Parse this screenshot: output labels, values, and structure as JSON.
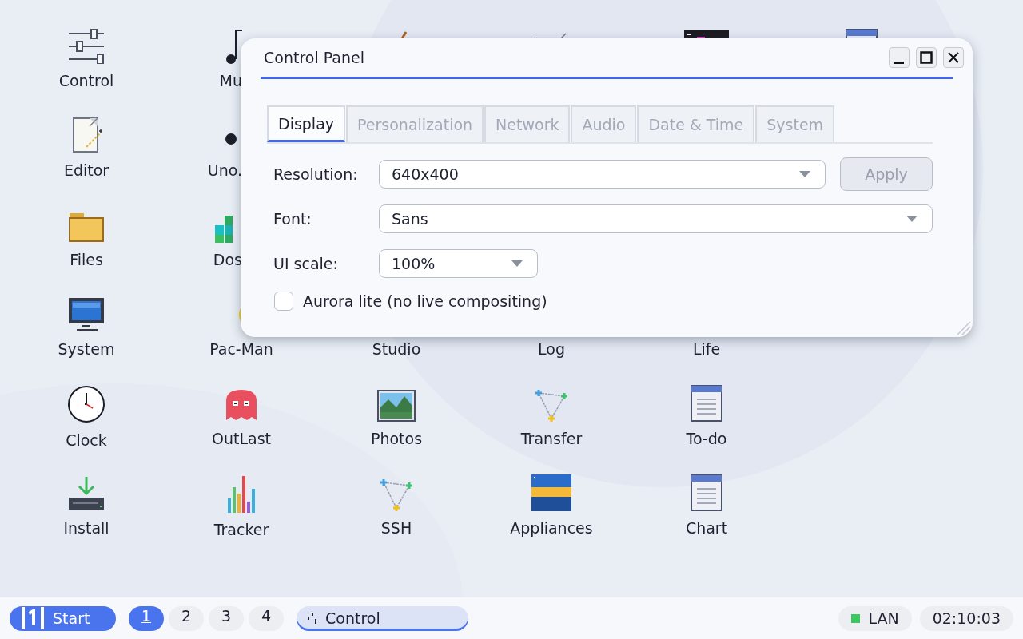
{
  "desktop": {
    "columns": [
      [
        {
          "kind": "app",
          "label": "Control"
        },
        {
          "kind": "app",
          "label": "Editor"
        },
        {
          "kind": "app",
          "label": "Files"
        },
        {
          "kind": "app",
          "label": "System"
        },
        {
          "kind": "app",
          "label": "Clock"
        },
        {
          "kind": "app",
          "label": "Install"
        }
      ],
      [
        {
          "kind": "clipped",
          "label": "Mu"
        },
        {
          "kind": "clipped",
          "label": "Uno."
        },
        {
          "kind": "clipped",
          "label": "Dos"
        },
        {
          "kind": "app",
          "label": "Pac-Man"
        },
        {
          "kind": "app",
          "label": "OutLast"
        },
        {
          "kind": "app",
          "label": "Tracker"
        }
      ],
      [
        {
          "kind": "app"
        },
        {
          "kind": "covered"
        },
        {
          "kind": "covered"
        },
        {
          "kind": "app",
          "label": "Studio"
        },
        {
          "kind": "app",
          "label": "Photos"
        },
        {
          "kind": "app",
          "label": "SSH"
        }
      ],
      [
        {
          "kind": "app"
        },
        {
          "kind": "covered"
        },
        {
          "kind": "covered"
        },
        {
          "kind": "app",
          "label": "Log"
        },
        {
          "kind": "app",
          "label": "Transfer"
        },
        {
          "kind": "app",
          "label": "Appliances"
        }
      ],
      [
        {
          "kind": "app"
        },
        {
          "kind": "covered"
        },
        {
          "kind": "covered"
        },
        {
          "kind": "app",
          "label": "Life"
        },
        {
          "kind": "app",
          "label": "To-do"
        },
        {
          "kind": "app",
          "label": "Chart"
        }
      ],
      [
        {
          "kind": "app"
        }
      ]
    ]
  },
  "window": {
    "title": "Control Panel",
    "tabs": [
      {
        "label": "Display",
        "selected": true
      },
      {
        "label": "Personalization",
        "selected": false
      },
      {
        "label": "Network",
        "selected": false
      },
      {
        "label": "Audio",
        "selected": false
      },
      {
        "label": "Date & Time",
        "selected": false
      },
      {
        "label": "System",
        "selected": false
      }
    ],
    "resolution": {
      "label": "Resolution:",
      "value": "640x400"
    },
    "apply_button": {
      "label": "Apply",
      "disabled": true
    },
    "font": {
      "label": "Font:",
      "value": "Sans"
    },
    "ui_scale": {
      "label": "UI scale:",
      "value": "100%"
    },
    "aurora_lite": {
      "label": "Aurora lite (no live compositing)",
      "checked": false
    }
  },
  "taskbar": {
    "start": {
      "label": "Start"
    },
    "workspaces": [
      {
        "label": "1",
        "selected": true
      },
      {
        "label": "2",
        "selected": false
      },
      {
        "label": "3",
        "selected": false
      },
      {
        "label": "4",
        "selected": false
      }
    ],
    "tasks": [
      {
        "label": "Control",
        "active": true
      }
    ],
    "network": {
      "label": "LAN",
      "connected": true
    },
    "clock": "02:10:03"
  }
}
